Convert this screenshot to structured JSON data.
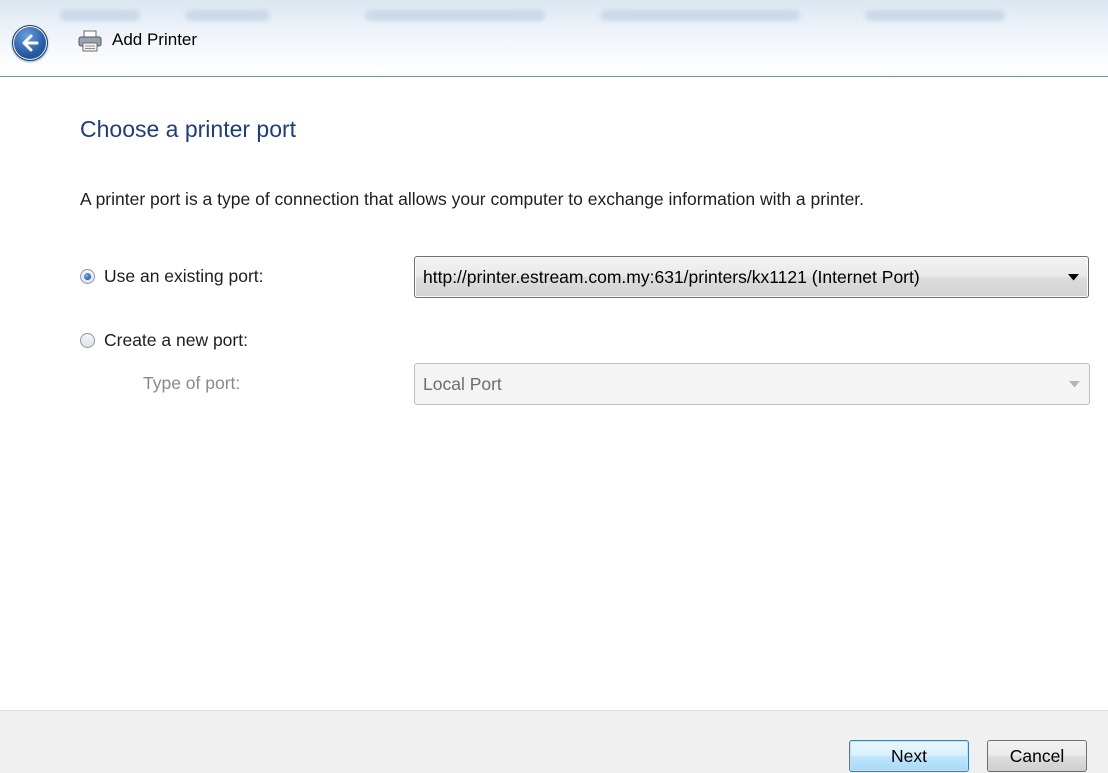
{
  "window": {
    "title": "Add Printer"
  },
  "page": {
    "heading": "Choose a printer port",
    "description": "A printer port is a type of connection that allows your computer to exchange information with a printer."
  },
  "options": {
    "existing": {
      "label": "Use an existing port:",
      "selected": true,
      "value": "http://printer.estream.com.my:631/printers/kx1121 (Internet Port)"
    },
    "create": {
      "label": "Create a new port:",
      "selected": false,
      "type_label": "Type of port:",
      "type_value": "Local Port",
      "enabled": false
    }
  },
  "buttons": {
    "next": "Next",
    "cancel": "Cancel"
  },
  "icons": {
    "back": "back-arrow-icon",
    "printer": "printer-icon",
    "dropdown": "chevron-down-icon"
  },
  "colors": {
    "heading": "#1c3d84",
    "disabled_text": "#8a8a8a",
    "default_button_border": "#3c7fb1"
  }
}
